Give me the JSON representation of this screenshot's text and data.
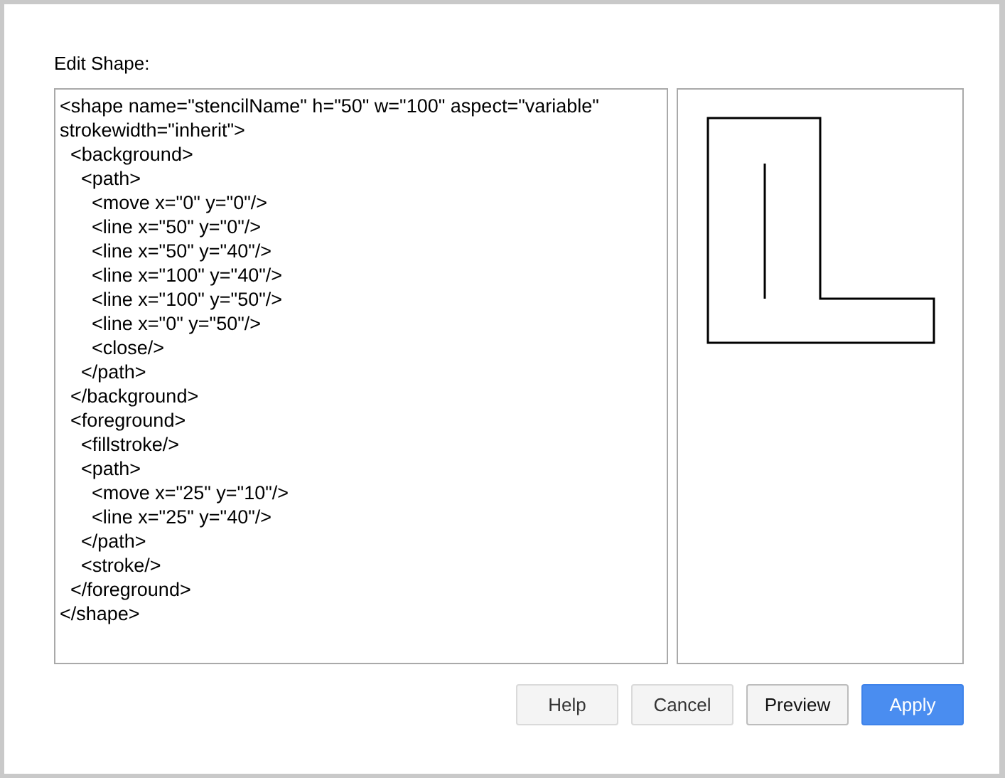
{
  "dialog": {
    "label": "Edit Shape:",
    "code": "<shape name=\"stencilName\" h=\"50\" w=\"100\" aspect=\"variable\" strokewidth=\"inherit\">\n  <background>\n    <path>\n      <move x=\"0\" y=\"0\"/>\n      <line x=\"50\" y=\"0\"/>\n      <line x=\"50\" y=\"40\"/>\n      <line x=\"100\" y=\"40\"/>\n      <line x=\"100\" y=\"50\"/>\n      <line x=\"0\" y=\"50\"/>\n      <close/>\n    </path>\n  </background>\n  <foreground>\n    <fillstroke/>\n    <path>\n      <move x=\"25\" y=\"10\"/>\n      <line x=\"25\" y=\"40\"/>\n    </path>\n    <stroke/>\n  </foreground>\n</shape>",
    "buttons": [
      {
        "label": "Help",
        "kind": "plain"
      },
      {
        "label": "Cancel",
        "kind": "plain"
      },
      {
        "label": "Preview",
        "kind": "default"
      },
      {
        "label": "Apply",
        "kind": "primary"
      }
    ]
  }
}
